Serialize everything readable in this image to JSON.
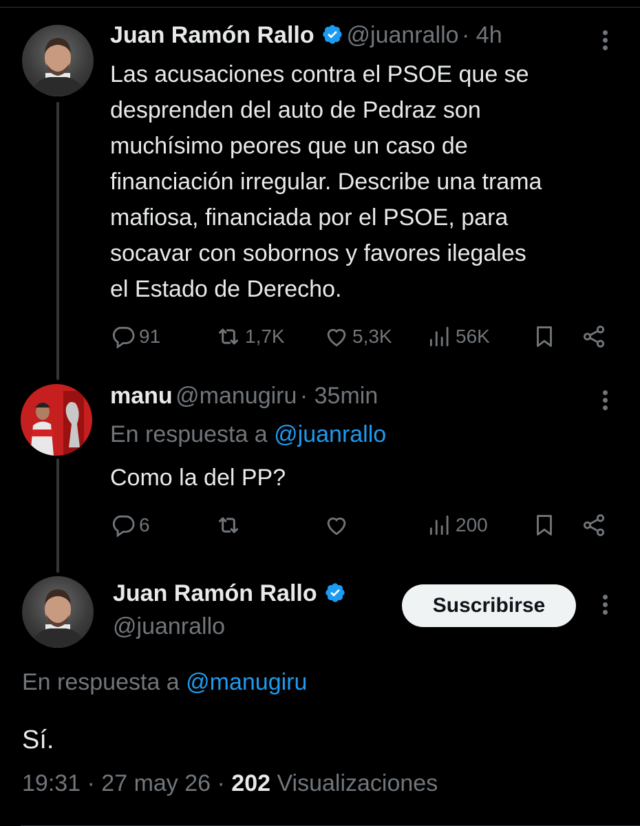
{
  "tweet1": {
    "name": "Juan Ramón Rallo",
    "handle": "@juanrallo",
    "time": "· 4h",
    "lines": [
      "Las acusaciones contra el PSOE que se",
      "desprenden del auto de Pedraz son",
      "muchísimo peores que un caso de",
      "financiación irregular. Describe una trama",
      "mafiosa, financiada por el PSOE, para",
      "socavar con sobornos y favores ilegales",
      "el Estado de Derecho."
    ],
    "replies": "91",
    "retweets": "1,7K",
    "likes": "5,3K",
    "views": "56K"
  },
  "tweet2": {
    "name": "manu",
    "handle": "@manugiru",
    "time": "· 35min",
    "reply_prefix": "En respuesta a",
    "reply_to": "@juanrallo",
    "text": "Como la del PP?",
    "replies": "6",
    "views": "200"
  },
  "tweet3": {
    "name": "Juan Ramón Rallo",
    "handle": "@juanrallo",
    "subscribe": "Suscribirse",
    "reply_prefix": "En respuesta a",
    "reply_to": "@manugiru",
    "text": "Sí.",
    "meta_time": "19:31 · 27 may 26 ·",
    "meta_views": "202",
    "meta_views_label": "Visualizaciones"
  },
  "colors": {
    "background": "#000000",
    "text": "#e7e9ea",
    "muted": "#71767b",
    "link": "#1d9bf0",
    "verified": "#1d9bf0"
  },
  "icons": [
    "verified-badge-icon",
    "more-icon",
    "reply-icon",
    "retweet-icon",
    "like-icon",
    "views-icon",
    "bookmark-icon",
    "share-icon"
  ]
}
